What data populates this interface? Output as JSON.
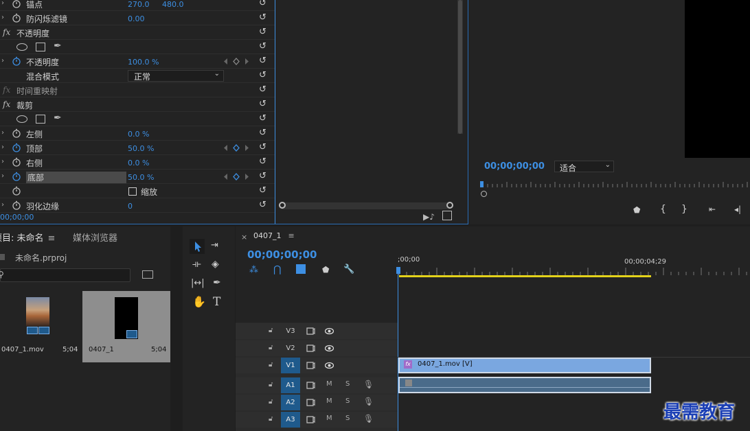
{
  "effects": {
    "rows": [
      {
        "label": "锚点",
        "value": "270.0",
        "value2": "480.0",
        "stopwatch": true,
        "twirl": true
      },
      {
        "label": "防闪烁滤镜",
        "value": "0.00",
        "stopwatch": true,
        "twirl": true
      },
      {
        "label": "不透明度",
        "fx": true
      },
      {
        "shapes": true
      },
      {
        "label": "不透明度",
        "value": "100.0 %",
        "stopwatch": true,
        "twirl": true,
        "active": true,
        "keyframes": true
      },
      {
        "label": "混合模式",
        "dropdown": "正常"
      },
      {
        "label": "时间重映射",
        "fx": true,
        "dim": true
      },
      {
        "label": "裁剪",
        "fx": true
      },
      {
        "shapes": true
      },
      {
        "label": "左侧",
        "value": "0.0 %",
        "stopwatch": true,
        "twirl": true
      },
      {
        "label": "顶部",
        "value": "50.0 %",
        "stopwatch": true,
        "twirl": true,
        "active": true,
        "keyframes": true
      },
      {
        "label": "右侧",
        "value": "0.0 %",
        "stopwatch": true,
        "twirl": true
      },
      {
        "label": "底部",
        "value": "50.0 %",
        "stopwatch": true,
        "twirl": true,
        "active": true,
        "keyframes": true,
        "highlight": true
      },
      {
        "label": "缩放",
        "checkbox": true,
        "stopwatch": true
      },
      {
        "label": "羽化边缘",
        "value": "0",
        "stopwatch": true,
        "twirl": true
      }
    ],
    "timecode": "00;00;00"
  },
  "program": {
    "timecode": "00;00;00;00",
    "fit": "适合"
  },
  "project": {
    "tab1": "项目: 未命名",
    "tab2": "媒体浏览器",
    "file": "未命名.prproj",
    "items": [
      {
        "name": "0407_1.mov",
        "dur": "5;04"
      },
      {
        "name": "0407_1",
        "dur": "5;04"
      }
    ]
  },
  "timeline": {
    "tab": "0407_1",
    "timecode": "00;00;00;00",
    "ruler_start": ";00;00",
    "ruler_end": "00;00;04;29",
    "tracks": [
      {
        "label": "V3",
        "kind": "video"
      },
      {
        "label": "V2",
        "kind": "video"
      },
      {
        "label": "V1",
        "kind": "video",
        "on": true
      },
      {
        "label": "A1",
        "kind": "audio",
        "on": true
      },
      {
        "label": "A2",
        "kind": "audio",
        "on": true
      },
      {
        "label": "A3",
        "kind": "audio",
        "on": true
      }
    ],
    "clip_video": "0407_1.mov [V]",
    "track_m": "M",
    "track_s": "S"
  },
  "watermark": "最需教育",
  "colors": {
    "accent": "#3d8fe3",
    "clip_video": "#7aa7e0",
    "clip_audio": "#4a6b8a",
    "workarea": "#e3d21a"
  }
}
